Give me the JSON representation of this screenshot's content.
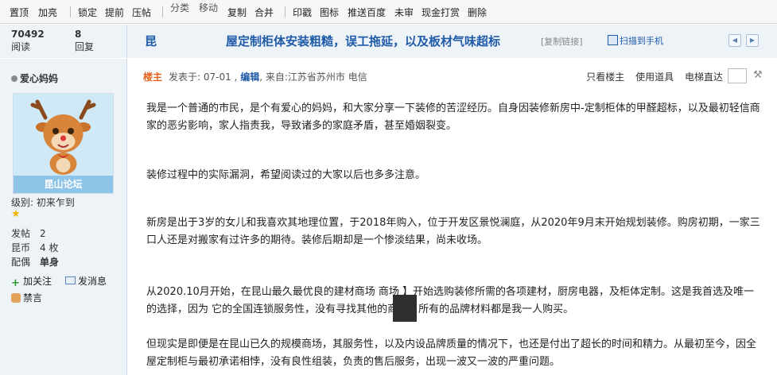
{
  "toolbar": {
    "items": [
      "置顶",
      "加亮",
      "锁定",
      "提前",
      "压帖",
      "分类",
      "移动",
      "复制",
      "合并",
      "印戳",
      "图标",
      "推送百度",
      "未审",
      "现金打赏",
      "删除"
    ]
  },
  "thread_stats": {
    "views": "70492",
    "views_label": "阅读",
    "replies": "8",
    "replies_label": "回复"
  },
  "thread": {
    "title_prefix": "昆",
    "title": "屋定制柜体安装粗糙，误工拖延，以及板材气味超标",
    "copy_link": "[复制链接]",
    "scan_label": "扫描到手机"
  },
  "author": {
    "name": "爱心妈妈",
    "avatar_banner": "昆山论坛",
    "level_label": "级别:",
    "level": "初来乍到",
    "posts_label": "发帖",
    "posts": "2",
    "coins_label": "昆币",
    "coins": "4 枚",
    "spouse_label": "配偶",
    "spouse": "单身",
    "follow": "加关注",
    "message": "发消息",
    "ban": "禁言"
  },
  "post": {
    "louzhu": "楼主",
    "posted_prefix": "发表于: 07-01 ,",
    "edit": "编辑",
    "from": ", 来自:江苏省苏州市 电信",
    "only_op": "只看楼主",
    "use_tools": "使用道具",
    "elevator": "电梯直达",
    "paragraphs": [
      "我是一个普通的市民，是个有爱心的妈妈，和大家分享一下装修的苦涩经历。自身因装修新房中-定制柜体的甲醛超标，以及最初轻信商家的恶劣影响，家人指责我，导致诸多的家庭矛盾，甚至婚姻裂变。",
      "装修过程中的实际漏洞，希望阅读过的大家以后也多多注意。",
      "新房是出于3岁的女儿和我喜欢其地理位置，于2018年购入，位于开发区景悦澜庭，从2020年9月末开始规划装修。购房初期，一家三口人还是对搬家有过许多的期待。装修后期却是一个惨淡结果，尚未收场。",
      "从2020.10月开始，在昆山最久最优良的建材商场                    商场                        】开始选购装修所需的各项建材，厨房电器，及柜体定制。这是我首选及唯一的选择，因为            它的全国连锁服务性，没有寻找其他的商场。所有的品牌材料都是我一人购买。",
      "但现实是即便是在昆山已久的规模商场，其服务性，以及内设品牌质量的情况下，也还是付出了超长的时间和精力。从最初至今，因全屋定制柜与最初承诺相悖，没有良性组装，负责的售后服务，出现一波又一波的严重问题。"
    ]
  }
}
